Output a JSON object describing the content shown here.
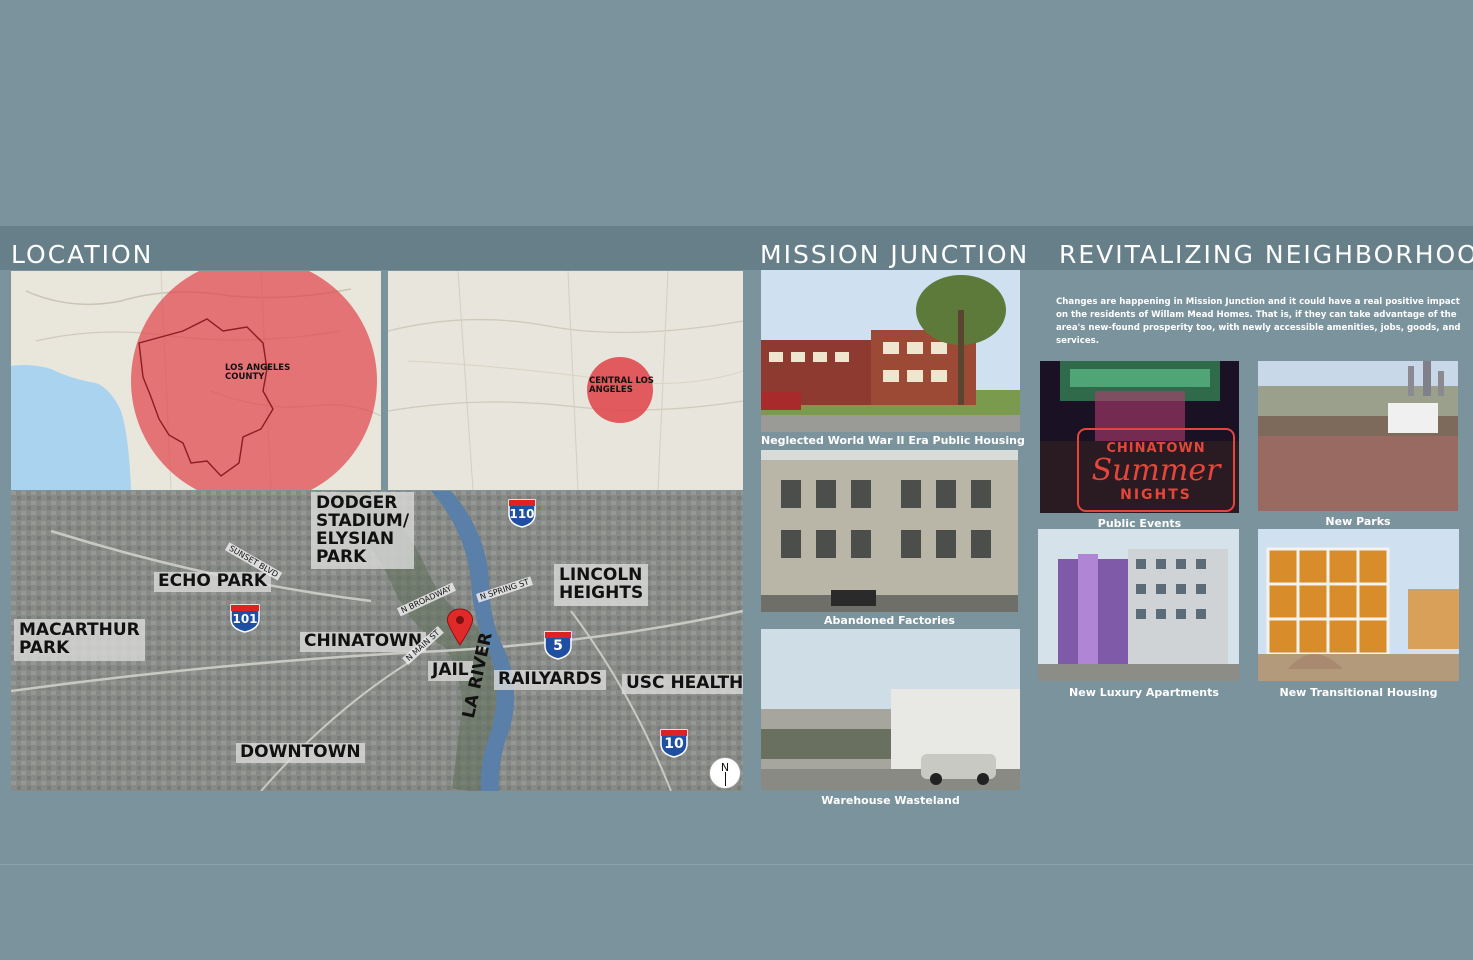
{
  "sections": {
    "location": "LOCATION",
    "mission_junction": "MISSION JUNCTION",
    "revitalizing": "REVITALIZING NEIGHBORHOOD"
  },
  "maps": {
    "county_label": "LOS ANGELES COUNTY",
    "central_label": "CENTRAL LOS ANGELES",
    "neighborhoods": {
      "dodger": [
        "DODGER",
        "STADIUM/",
        "ELYSIAN",
        "PARK"
      ],
      "echo_park": "ECHO PARK",
      "lincoln": [
        "LINCOLN",
        "HEIGHTS"
      ],
      "macarthur": [
        "MACARTHUR",
        "PARK"
      ],
      "chinatown": "CHINATOWN",
      "jail": "JAIL",
      "railyards": "RAILYARDS",
      "usc": "USC HEALTH",
      "downtown": "DOWNTOWN",
      "la_river": "LA RIVER"
    },
    "streets": {
      "sunset": "SUNSET BLVD",
      "broadway": "N BROADWAY",
      "spring": "N SPRING ST",
      "main": "N MAIN ST"
    },
    "highways": {
      "h110": "110",
      "h101": "101",
      "h5": "5",
      "h10": "10"
    },
    "north": "N"
  },
  "mission": {
    "photos": [
      "Neglected World War II Era Public Housing",
      "Abandoned Factories",
      "Warehouse Wasteland"
    ]
  },
  "revitalizing": {
    "intro": "Changes are happening in Mission Junction and it could have a real positive impact on the residents of Willam Mead Homes. That is, if they can take advantage of the area's new-found prosperity too, with newly accessible amenities, jobs, goods, and services.",
    "sign_top": "CHINATOWN",
    "sign_mid": "Summer",
    "sign_bot": "NIGHTS",
    "captions": {
      "events": "Public Events",
      "parks": "New Parks",
      "apartments": "New Luxury Apartments",
      "transitional": "New Transitional Housing"
    }
  },
  "colors": {
    "background": "#7b939c",
    "band": "#677f89",
    "circle": "#e0474c",
    "river": "#5a7fa8"
  }
}
